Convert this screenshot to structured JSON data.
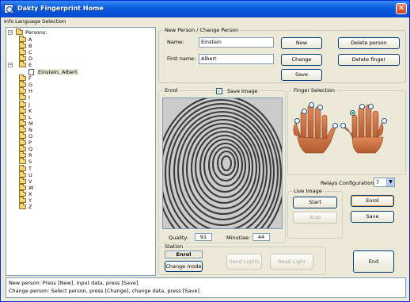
{
  "window": {
    "title": "Dakty Fingerprint Home",
    "close_glyph": "✕"
  },
  "menu": {
    "items": [
      "Info",
      "Language Selection"
    ]
  },
  "tree": {
    "root_label": "Persons:",
    "letters": [
      "A",
      "B",
      "C",
      "D",
      "E",
      "F",
      "G",
      "H",
      "I",
      "J",
      "K",
      "L",
      "M",
      "N",
      "O",
      "P",
      "Q",
      "R",
      "S",
      "T",
      "U",
      "V",
      "W",
      "X",
      "Y",
      "Z"
    ],
    "expanded_letter": "E",
    "child_label": "Einstein, Albert"
  },
  "person_group": {
    "title": "New Person / Change Person",
    "name_label": "Name:",
    "name_value": "Einstein",
    "firstname_label": "First name:",
    "firstname_value": "Albert",
    "new_button": "New",
    "change_button": "Change",
    "save_button": "Save",
    "delete_person_button": "Delete person",
    "delete_finger_button": "Delete finger"
  },
  "enrol_group": {
    "title": "Enrol",
    "save_image_label": "Save Image",
    "save_image_checked": true,
    "quality_label": "Quality:",
    "quality_value": "91",
    "minutiae_label": "Minutiae:",
    "minutiae_value": "44"
  },
  "finger_group": {
    "title": "Finger Selection",
    "selected_finger": "left-index",
    "relays_label": "Relays Configuration:",
    "relays_value": "7"
  },
  "live_image_group": {
    "title": "Live Image",
    "start_button": "Start",
    "stop_button": "Stop"
  },
  "actions": {
    "enrol_button": "Enrol",
    "save_button": "Save",
    "end_button": "End"
  },
  "station_group": {
    "title": "Station",
    "mode_value": "Enrol",
    "change_mode_button": "Change mode",
    "send_button": "Send Lights",
    "read_button": "Read Light"
  },
  "status": {
    "line1": "New person: Press [New], input data, press [Save].",
    "line2": "Change person: Select person, press [Change], change data, press [Save]."
  },
  "colors": {
    "title_bar": "#0a5fdc",
    "window_bg": "#ece9d8",
    "hand_skin": "#c96a40"
  }
}
